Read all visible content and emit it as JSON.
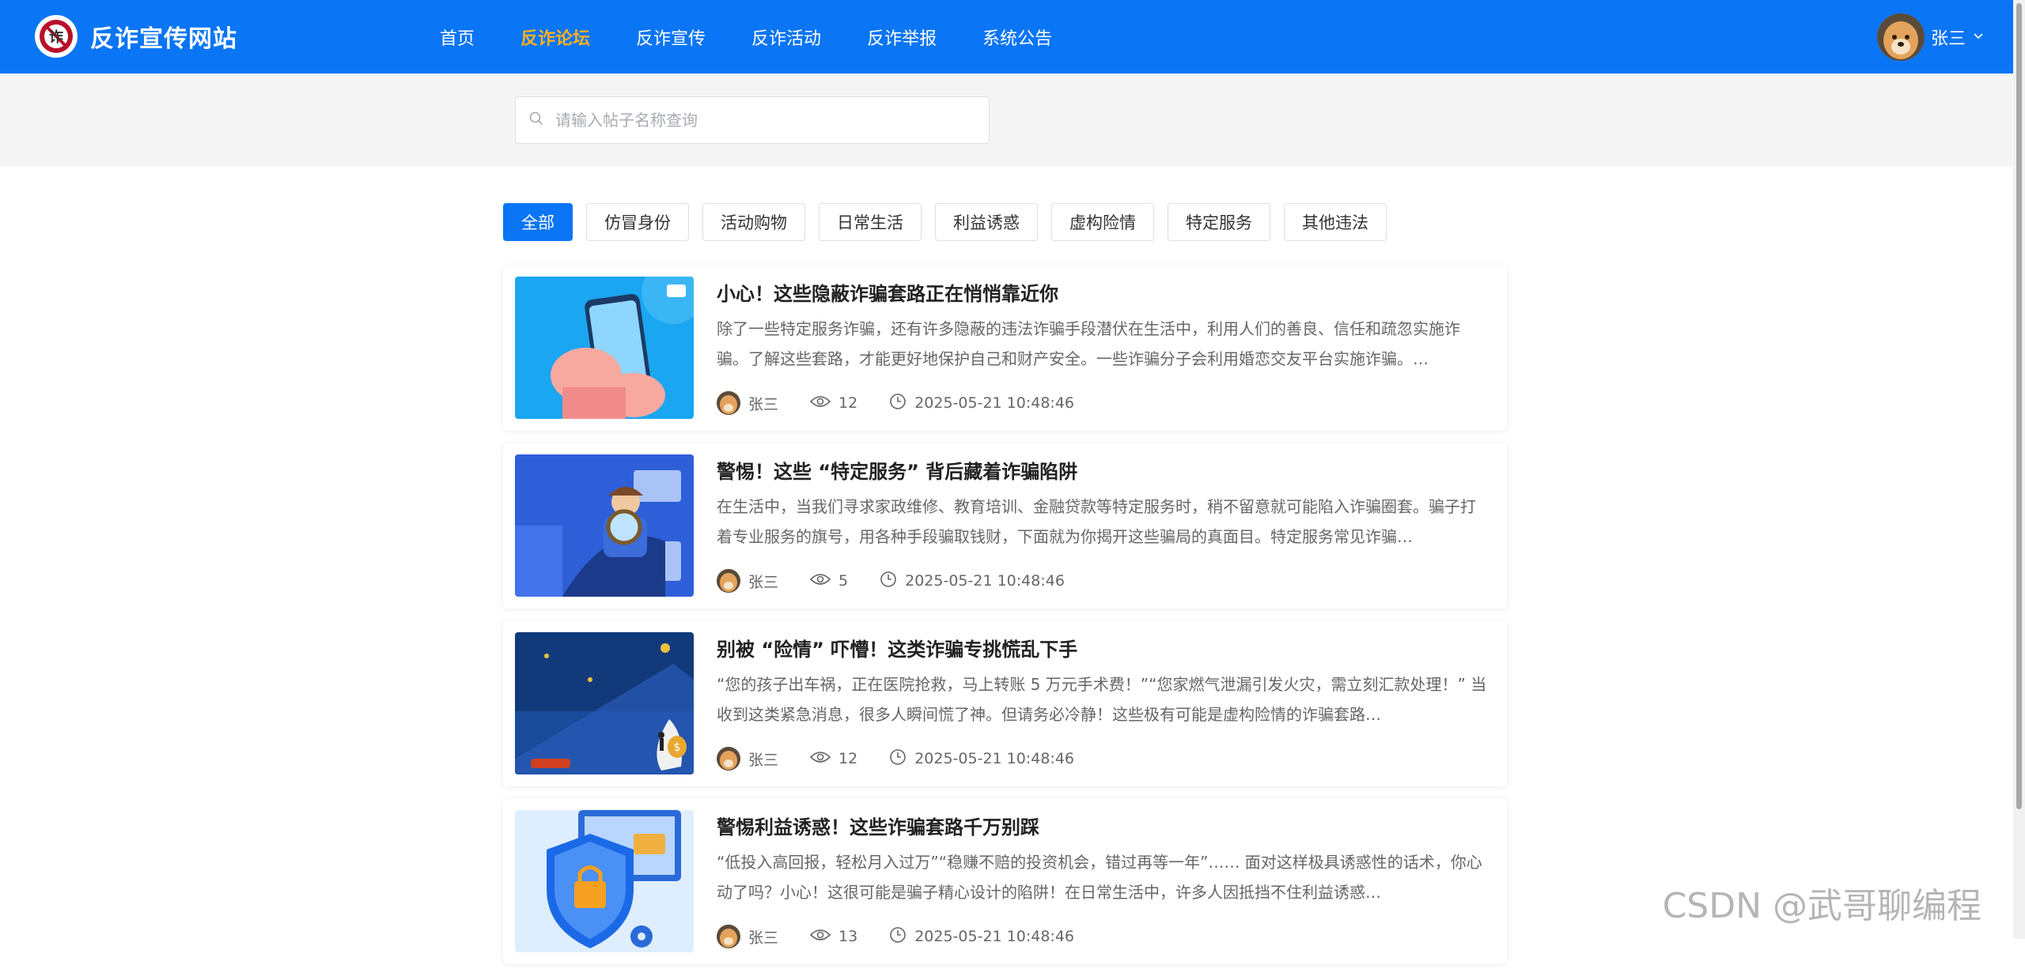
{
  "site": {
    "title": "反诈宣传网站"
  },
  "nav": [
    {
      "label": "首页",
      "active": false
    },
    {
      "label": "反诈论坛",
      "active": true
    },
    {
      "label": "反诈宣传",
      "active": false
    },
    {
      "label": "反诈活动",
      "active": false
    },
    {
      "label": "反诈举报",
      "active": false
    },
    {
      "label": "系统公告",
      "active": false
    }
  ],
  "user": {
    "name": "张三"
  },
  "search": {
    "placeholder": "请输入帖子名称查询"
  },
  "categories": [
    "全部",
    "仿冒身份",
    "活动购物",
    "日常生活",
    "利益诱惑",
    "虚构险情",
    "特定服务",
    "其他违法"
  ],
  "posts": [
    {
      "title": "小心！这些隐蔽诈骗套路正在悄悄靠近你",
      "desc": "除了一些特定服务诈骗，还有许多隐蔽的违法诈骗手段潜伏在生活中，利用人们的善良、信任和疏忽实施诈骗。了解这些套路，才能更好地保护自己和财产安全。一些诈骗分子会利用婚恋交友平台实施诈骗。…",
      "author": "张三",
      "views": "12",
      "time": "2025-05-21 10:48:46"
    },
    {
      "title": "警惕！这些 “特定服务” 背后藏着诈骗陷阱",
      "desc": "在生活中，当我们寻求家政维修、教育培训、金融贷款等特定服务时，稍不留意就可能陷入诈骗圈套。骗子打着专业服务的旗号，用各种手段骗取钱财，下面就为你揭开这些骗局的真面目。特定服务常见诈骗…",
      "author": "张三",
      "views": "5",
      "time": "2025-05-21 10:48:46"
    },
    {
      "title": "别被 “险情” 吓懵！这类诈骗专挑慌乱下手",
      "desc": "“您的孩子出车祸，正在医院抢救，马上转账 5 万元手术费！”“您家燃气泄漏引发火灾，需立刻汇款处理！” 当收到这类紧急消息，很多人瞬间慌了神。但请务必冷静！这些极有可能是虚构险情的诈骗套路…",
      "author": "张三",
      "views": "12",
      "time": "2025-05-21 10:48:46"
    },
    {
      "title": "警惕利益诱惑！这些诈骗套路千万别踩",
      "desc": "“低投入高回报，轻松月入过万”“稳赚不赔的投资机会，错过再等一年”…… 面对这样极具诱惑性的话术，你心动了吗？小心！这很可能是骗子精心设计的陷阱！在日常生活中，许多人因抵挡不住利益诱惑…",
      "author": "张三",
      "views": "13",
      "time": "2025-05-21 10:48:46"
    }
  ],
  "watermark": "CSDN @武哥聊编程",
  "colors": {
    "primary": "#0a75f5",
    "nav_active": "#ffb020"
  }
}
